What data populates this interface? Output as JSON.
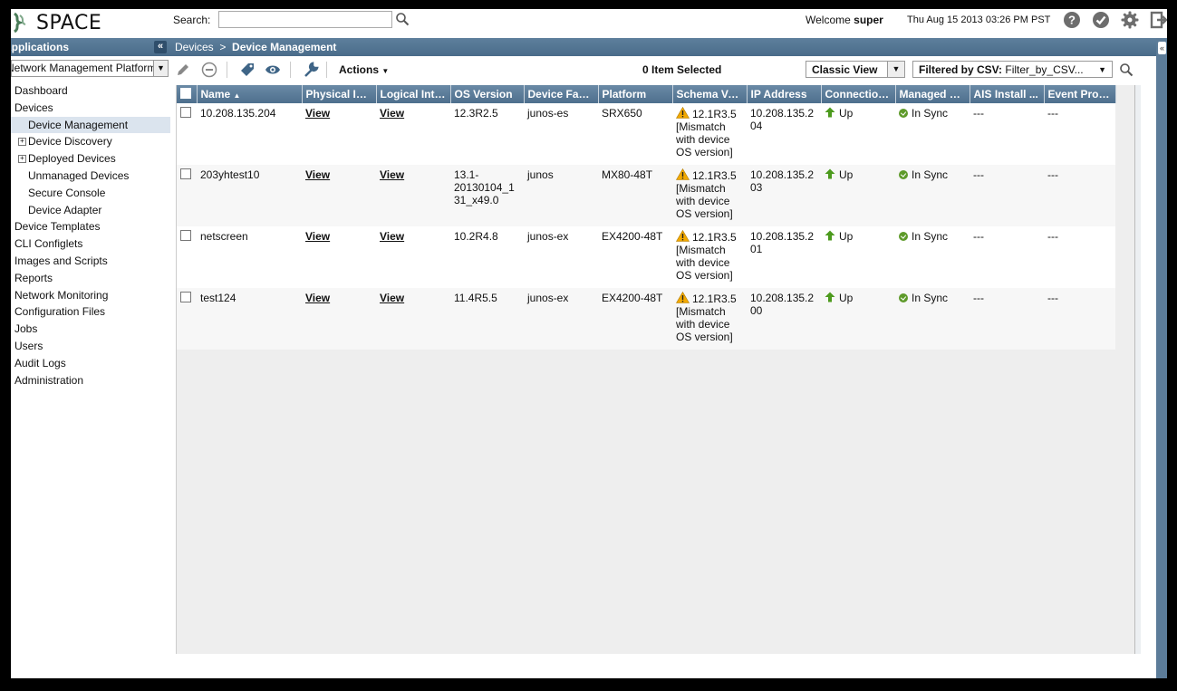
{
  "header": {
    "logo_text": "SPACE",
    "search_label": "Search:",
    "search_value": "",
    "welcome_prefix": "Welcome",
    "welcome_user": "super",
    "datetime": "Thu Aug 15 2013 03:26 PM PST",
    "icons": [
      "help-icon",
      "check-icon",
      "gear-icon",
      "logout-icon"
    ]
  },
  "sidebar": {
    "title": "Applications",
    "collapse_label": "«",
    "app_select": "Network Management Platform",
    "items": [
      {
        "label": "Dashboard",
        "level": 0
      },
      {
        "label": "Devices",
        "level": 0
      },
      {
        "label": "Device Management",
        "level": 1,
        "selected": true
      },
      {
        "label": "Device Discovery",
        "level": 1,
        "expandable": true
      },
      {
        "label": "Deployed Devices",
        "level": 1,
        "expandable": true
      },
      {
        "label": "Unmanaged Devices",
        "level": 1
      },
      {
        "label": "Secure Console",
        "level": 1
      },
      {
        "label": "Device Adapter",
        "level": 1
      },
      {
        "label": "Device Templates",
        "level": 0
      },
      {
        "label": "CLI Configlets",
        "level": 0
      },
      {
        "label": "Images and Scripts",
        "level": 0
      },
      {
        "label": "Reports",
        "level": 0
      },
      {
        "label": "Network Monitoring",
        "level": 0
      },
      {
        "label": "Configuration Files",
        "level": 0
      },
      {
        "label": "Jobs",
        "level": 0
      },
      {
        "label": "Users",
        "level": 0
      },
      {
        "label": "Audit Logs",
        "level": 0
      },
      {
        "label": "Administration",
        "level": 0
      }
    ]
  },
  "breadcrumb": {
    "root": "Devices",
    "separator": ">",
    "current": "Device Management"
  },
  "toolbar": {
    "actions_label": "Actions",
    "selected_count": "0 Item Selected",
    "view_select": "Classic View",
    "filter_label": "Filtered by CSV:",
    "filter_value": "Filter_by_CSV...",
    "icons": [
      "edit-icon",
      "delete-icon",
      "tag-icon",
      "view-icon",
      "wrench-icon"
    ]
  },
  "grid": {
    "columns": [
      "Name",
      "Physical Int...",
      "Logical Inte...",
      "OS Version",
      "Device Family",
      "Platform",
      "Schema Ve...",
      "IP Address",
      "Connection...",
      "Managed S...",
      "AIS Install ...",
      "Event Profile"
    ],
    "sort_indicator": "▲",
    "rows": [
      {
        "name": "10.208.135.204",
        "physical": "View",
        "logical": "View",
        "os": "12.3R2.5",
        "family": "junos-es",
        "platform": "SRX650",
        "schema": "12.1R3.5 [Mismatch with device OS version]",
        "ip": "10.208.135.204",
        "connection": "Up",
        "managed": "In Sync",
        "ais": "---",
        "event": "---"
      },
      {
        "name": "203yhtest10",
        "physical": "View",
        "logical": "View",
        "os": "13.1-20130104_131_x49.0",
        "family": "junos",
        "platform": "MX80-48T",
        "schema": "12.1R3.5 [Mismatch with device OS version]",
        "ip": "10.208.135.203",
        "connection": "Up",
        "managed": "In Sync",
        "ais": "---",
        "event": "---"
      },
      {
        "name": "netscreen",
        "physical": "View",
        "logical": "View",
        "os": "10.2R4.8",
        "family": "junos-ex",
        "platform": "EX4200-48T",
        "schema": "12.1R3.5 [Mismatch with device OS version]",
        "ip": "10.208.135.201",
        "connection": "Up",
        "managed": "In Sync",
        "ais": "---",
        "event": "---"
      },
      {
        "name": "test124",
        "physical": "View",
        "logical": "View",
        "os": "11.4R5.5",
        "family": "junos-ex",
        "platform": "EX4200-48T",
        "schema": "12.1R3.5 [Mismatch with device OS version]",
        "ip": "10.208.135.200",
        "connection": "Up",
        "managed": "In Sync",
        "ais": "---",
        "event": "---"
      }
    ]
  },
  "colors": {
    "header_blue": "#4a6c8a",
    "column_header_blue": "#5a7a97",
    "selected_row": "#dbe4ee",
    "status_up": "#4c9a1d",
    "status_sync": "#5e9a2a",
    "warning": "#f2a900"
  }
}
